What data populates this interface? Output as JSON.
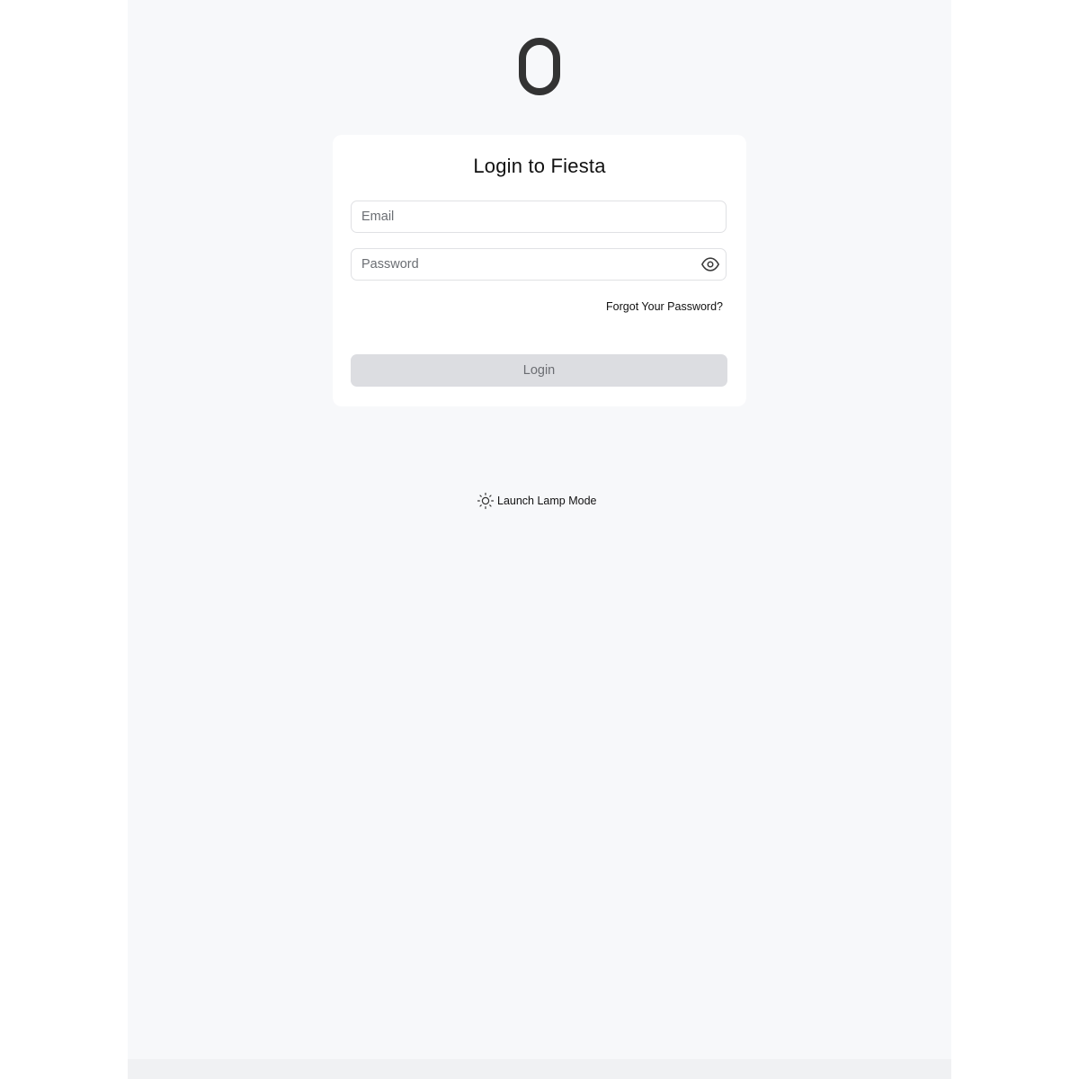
{
  "card": {
    "title": "Login to Fiesta"
  },
  "form": {
    "email_placeholder": "Email",
    "email_value": "",
    "password_placeholder": "Password",
    "password_value": "",
    "forgot_label": "Forgot Your Password?",
    "login_label": "Login"
  },
  "footer": {
    "lamp_mode_label": "Launch Lamp Mode"
  },
  "icons": {
    "logo": "logo-icon",
    "password_toggle": "eye-icon",
    "lamp_mode": "sun-icon"
  },
  "colors": {
    "background": "#f7f8fa",
    "card": "#ffffff",
    "button_disabled": "#dcdde1",
    "logo": "#333333"
  }
}
